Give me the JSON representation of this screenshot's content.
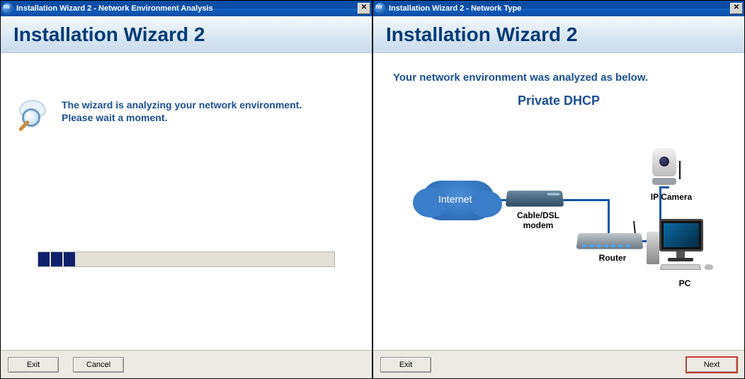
{
  "left": {
    "title": "Installation Wizard 2 - Network Environment Analysis",
    "headerTitle": "Installation Wizard 2",
    "analyzeLine1": "The wizard is analyzing your network environment.",
    "analyzeLine2": "Please wait a moment.",
    "progressSegments": 3,
    "buttons": {
      "exit": "Exit",
      "cancel": "Cancel"
    }
  },
  "right": {
    "title": "Installation Wizard 2 - Network Type",
    "headerTitle": "Installation Wizard 2",
    "resultHead": "Your network environment was analyzed as below.",
    "resultType": "Private DHCP",
    "labels": {
      "internet": "Internet",
      "modem": "Cable/DSL\nmodem",
      "router": "Router",
      "ipcamera": "IP Camera",
      "pc": "PC"
    },
    "buttons": {
      "exit": "Exit",
      "next": "Next"
    }
  }
}
